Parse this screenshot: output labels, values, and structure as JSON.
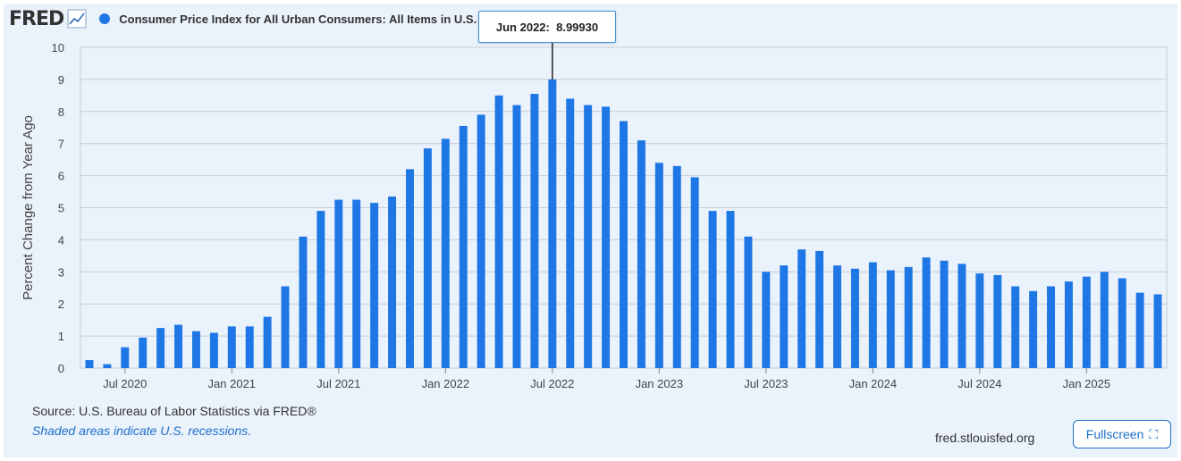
{
  "header": {
    "logo": "FRED",
    "logo_icon": "line-chart-icon",
    "series_title": "Consumer Price Index for All Urban Consumers: All Items in U.S. City Average"
  },
  "tooltip": {
    "date": "Jun 2022:",
    "value": "8.99930"
  },
  "footer": {
    "source": "Source: U.S. Bureau of Labor Statistics via FRED®",
    "note": "Shaded areas indicate U.S. recessions.",
    "link": "fred.stlouisfed.org",
    "fullscreen_label": "Fullscreen",
    "fullscreen_icon": "expand-icon"
  },
  "colors": {
    "bar": "#1f77e6",
    "grid": "#c7ccd1",
    "axis_text": "#444444"
  },
  "chart_data": {
    "type": "bar",
    "ylabel": "Percent Change from Year Ago",
    "ylim": [
      0,
      10
    ],
    "yticks": [
      "0",
      "1",
      "2",
      "3",
      "4",
      "5",
      "6",
      "7",
      "8",
      "9",
      "10"
    ],
    "grid": true,
    "x_tick_labels": [
      {
        "label": "Jul 2020",
        "index": 2
      },
      {
        "label": "Jan 2021",
        "index": 8
      },
      {
        "label": "Jul 2021",
        "index": 14
      },
      {
        "label": "Jan 2022",
        "index": 20
      },
      {
        "label": "Jul 2022",
        "index": 26
      },
      {
        "label": "Jan 2023",
        "index": 32
      },
      {
        "label": "Jul 2023",
        "index": 38
      },
      {
        "label": "Jan 2024",
        "index": 44
      },
      {
        "label": "Jul 2024",
        "index": 50
      },
      {
        "label": "Jan 2025",
        "index": 56
      }
    ],
    "categories": [
      "May 2020",
      "Jun 2020",
      "Jul 2020",
      "Aug 2020",
      "Sep 2020",
      "Oct 2020",
      "Nov 2020",
      "Dec 2020",
      "Jan 2021",
      "Feb 2021",
      "Mar 2021",
      "Apr 2021",
      "May 2021",
      "Jun 2021",
      "Jul 2021",
      "Aug 2021",
      "Sep 2021",
      "Oct 2021",
      "Nov 2021",
      "Dec 2021",
      "Jan 2022",
      "Feb 2022",
      "Mar 2022",
      "Apr 2022",
      "May 2022",
      "Jun 2022",
      "Jul 2022",
      "Aug 2022",
      "Sep 2022",
      "Oct 2022",
      "Nov 2022",
      "Dec 2022",
      "Jan 2023",
      "Feb 2023",
      "Mar 2023",
      "Apr 2023",
      "May 2023",
      "Jun 2023",
      "Jul 2023",
      "Aug 2023",
      "Sep 2023",
      "Oct 2023",
      "Nov 2023",
      "Dec 2023",
      "Jan 2024",
      "Feb 2024",
      "Mar 2024",
      "Apr 2024",
      "May 2024",
      "Jun 2024",
      "Jul 2024",
      "Aug 2024",
      "Sep 2024",
      "Oct 2024",
      "Nov 2024",
      "Dec 2024",
      "Jan 2025",
      "Feb 2025",
      "Mar 2025",
      "Apr 2025",
      "May 2025"
    ],
    "values": [
      0.25,
      0.12,
      0.65,
      0.95,
      1.25,
      1.35,
      1.15,
      1.1,
      1.3,
      1.3,
      1.6,
      2.55,
      4.1,
      4.9,
      5.25,
      5.25,
      5.15,
      5.35,
      6.2,
      6.85,
      7.15,
      7.55,
      7.9,
      8.5,
      8.2,
      8.55,
      8.9993,
      8.4,
      8.2,
      8.15,
      7.7,
      7.1,
      6.4,
      6.3,
      5.95,
      4.9,
      4.9,
      4.1,
      3.0,
      3.2,
      3.7,
      3.65,
      3.2,
      3.1,
      3.3,
      3.05,
      3.15,
      3.45,
      3.35,
      3.25,
      2.95,
      2.9,
      2.55,
      2.4,
      2.55,
      2.7,
      2.85,
      3.0,
      2.8,
      2.35,
      2.3
    ],
    "highlight_index": 26
  }
}
